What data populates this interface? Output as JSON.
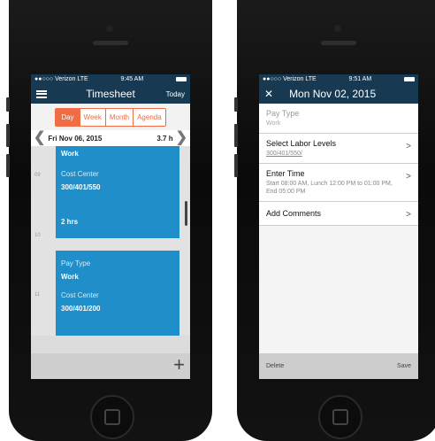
{
  "left": {
    "status": {
      "carrier": "●●○○○ Verizon  LTE",
      "time": "9:45 AM"
    },
    "header": {
      "title": "Timesheet",
      "today": "Today"
    },
    "segments": [
      "Day",
      "Week",
      "Month",
      "Agenda"
    ],
    "date_bar": {
      "date": "Fri Nov 06, 2015",
      "hours": "3.7 h"
    },
    "hours": [
      "09",
      "10",
      "11"
    ],
    "events": [
      {
        "pay_label": "Work",
        "cost_center_label": "Cost Center",
        "cost_center_value": "300/401/550",
        "duration": "2 hrs"
      },
      {
        "pay_type_label": "Pay Type",
        "pay_value": "Work",
        "cost_center_label": "Cost Center",
        "cost_center_value": "300/401/200"
      }
    ],
    "add_icon": "plus-icon"
  },
  "right": {
    "status": {
      "carrier": "●●○○○ Verizon  LTE",
      "time": "9:51 AM"
    },
    "header": {
      "close_icon": "close-icon",
      "title": "Mon Nov 02, 2015"
    },
    "rows": [
      {
        "title": "Pay Type",
        "sub": "Work"
      },
      {
        "title": "Select Labor Levels",
        "sub": "300/401/550/"
      },
      {
        "title": "Enter Time",
        "sub": "Start 08:00 AM, Lunch 12:00 PM to 01:00 PM, End 05:00 PM"
      },
      {
        "title": "Add Comments",
        "sub": ""
      }
    ],
    "footer": {
      "delete": "Delete",
      "save": "Save"
    }
  },
  "colors": {
    "accent": "#ef6c45",
    "header": "#173a52",
    "event": "#1f8ec9"
  }
}
